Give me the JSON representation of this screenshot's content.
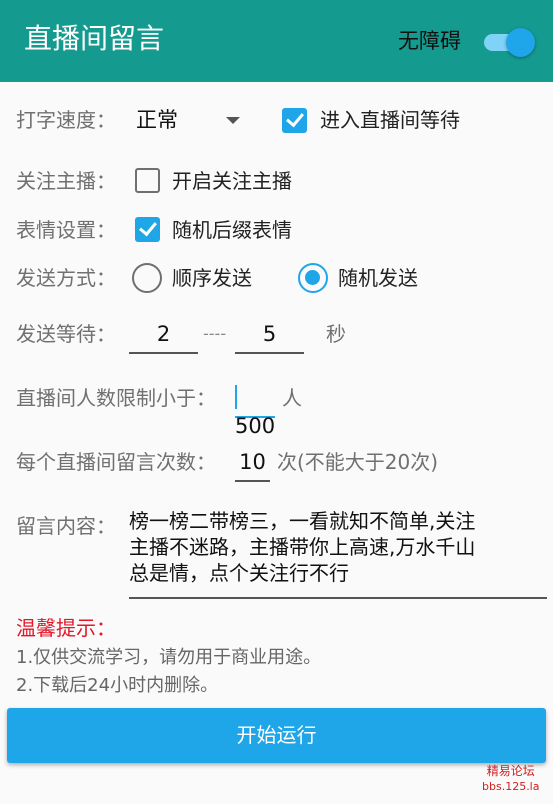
{
  "appbar": {
    "title": "直播间留言",
    "a11y_label": "无障碍",
    "a11y_switch_on": true
  },
  "typing": {
    "label": "打字速度：",
    "value": "正常",
    "wait_checkbox_label": "进入直播间等待",
    "wait_checked": true
  },
  "follow": {
    "label": "关注主播：",
    "checkbox_label": "开启关注主播",
    "checked": false
  },
  "emoji": {
    "label": "表情设置：",
    "checkbox_label": "随机后缀表情",
    "checked": true
  },
  "send_mode": {
    "label": "发送方式：",
    "options": [
      "顺序发送",
      "随机发送"
    ],
    "selected": "随机发送"
  },
  "send_wait": {
    "label": "发送等待：",
    "min": "2",
    "separator": "----",
    "max": "5",
    "unit": "秒"
  },
  "viewer_limit": {
    "label": "直播间人数限制小于：",
    "value": "500",
    "unit": "人"
  },
  "msg_count": {
    "label": "每个直播间留言次数：",
    "value": "10",
    "note": "次(不能大于20次)"
  },
  "content": {
    "label": "留言内容：",
    "value": "榜一榜二带榜三，一看就知不简单,关注\n主播不迷路，主播带你上高速,万水千山\n总是情，点个关注行不行"
  },
  "tips": {
    "title": "温馨提示：",
    "items": [
      "1.仅供交流学习，请勿用于商业用途。",
      "2.下载后24小时内删除。"
    ]
  },
  "start_button": {
    "label": "开始运行"
  },
  "watermark": {
    "line1": "精易论坛",
    "line2": "bbs.125.la"
  },
  "colors": {
    "appbar": "#159a8f",
    "accent": "#1fa6e9",
    "warning": "#e0182a"
  }
}
